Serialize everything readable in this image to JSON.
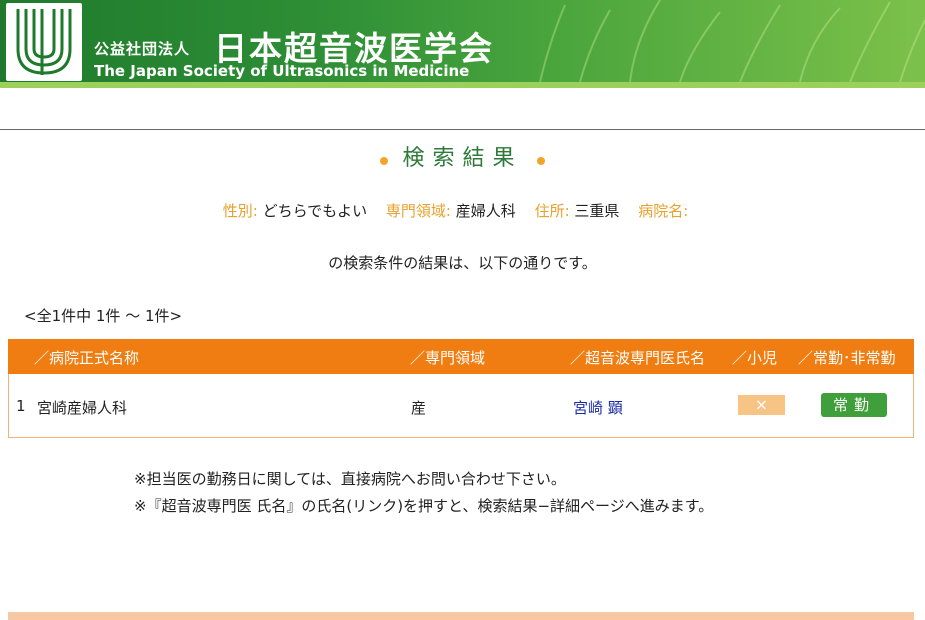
{
  "header": {
    "org_prefix": "公益社団法人",
    "org_name": "日本超音波医学会",
    "org_name_en": "The Japan Society of Ultrasonics in Medicine"
  },
  "page": {
    "title": "検索結果"
  },
  "conditions": {
    "gender_label": "性別:",
    "gender_value": "どちらでもよい",
    "specialty_label": "専門領域:",
    "specialty_value": "産婦人科",
    "address_label": "住所:",
    "address_value": "三重県",
    "hospital_label": "病院名:",
    "hospital_value": ""
  },
  "result_note": "の検索条件の結果は、以下の通りです。",
  "count_text": "<全1件中 1件 〜 1件>",
  "table": {
    "headers": [
      "／病院正式名称",
      "／専門領域",
      "／超音波専門医氏名",
      "／小児",
      "／常勤･非常勤"
    ],
    "rows": [
      {
        "index": "1",
        "hospital": "宮崎産婦人科",
        "specialty": "産",
        "doctor": "宮崎 顕",
        "pediatric": "×",
        "employment": "常勤"
      }
    ]
  },
  "notes": [
    "※担当医の勤務日に関しては、直接病院へお問い合わせ下さい。",
    "※『超音波専門医 氏名』の氏名(リンク)を押すと、検索結果−詳細ページへ進みます。"
  ],
  "colors": {
    "header_green": "#2e8f36",
    "table_orange": "#ef7d12",
    "label_orange": "#e7a12d",
    "title_green": "#2e7a3a",
    "link_blue": "#1a2aa8"
  }
}
